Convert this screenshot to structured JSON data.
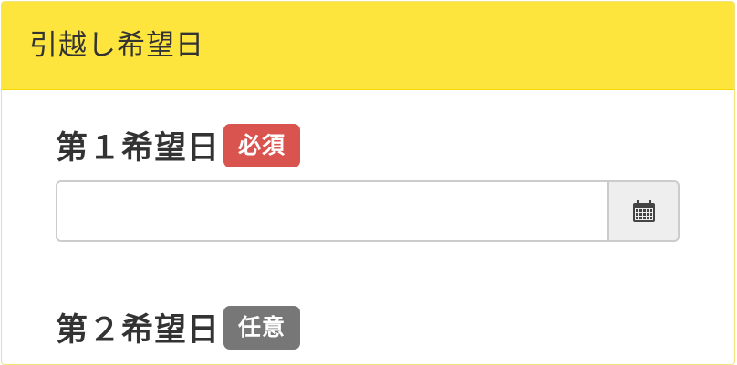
{
  "panel": {
    "title": "引越し希望日"
  },
  "fields": [
    {
      "label": "第１希望日",
      "badge": "必須",
      "value": "",
      "icon": "calendar-icon"
    },
    {
      "label": "第２希望日",
      "badge": "任意"
    }
  ],
  "colors": {
    "heading_bg": "#fde53e",
    "required_badge": "#d9534f",
    "optional_badge": "#777777"
  }
}
